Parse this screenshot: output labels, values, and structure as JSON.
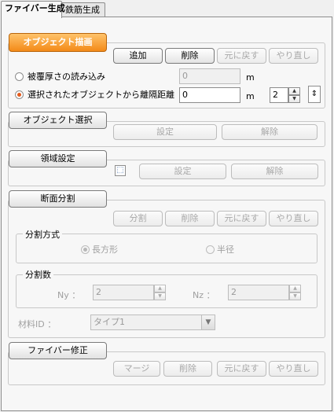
{
  "tabs": [
    "ファイバー生成",
    "鉄筋生成"
  ],
  "fiber_draw": {
    "header": "オブジェクト描画",
    "buttons": {
      "add": "追加",
      "delete": "削除",
      "undo": "元に戻す",
      "redo": "やり直し"
    },
    "opt_cover": {
      "label": "被覆厚さの読み込み",
      "value": "0",
      "unit": "m"
    },
    "opt_offset": {
      "label": "選択されたオブジェクトから離隔距離",
      "value": "0",
      "unit": "m",
      "count": "2"
    }
  },
  "object_select": {
    "header": "オブジェクト選択",
    "set": "設定",
    "release": "解除"
  },
  "region_set": {
    "header": "領域設定",
    "set": "設定",
    "release": "解除"
  },
  "section_split": {
    "header": "断面分割",
    "buttons": {
      "split": "分割",
      "delete": "削除",
      "undo": "元に戻す",
      "redo": "やり直し"
    },
    "method": {
      "title": "分割方式",
      "rect": "長方形",
      "radius": "半径"
    },
    "count": {
      "title": "分割数",
      "ny_label": "Ny ：",
      "ny_value": "2",
      "nz_label": "Nz ：",
      "nz_value": "2"
    },
    "material": {
      "label": "材料ID ：",
      "value": "タイプ1"
    }
  },
  "fiber_edit": {
    "header": "ファイバー修正",
    "buttons": {
      "merge": "マージ",
      "delete": "削除",
      "undo": "元に戻す",
      "redo": "やり直し"
    }
  }
}
